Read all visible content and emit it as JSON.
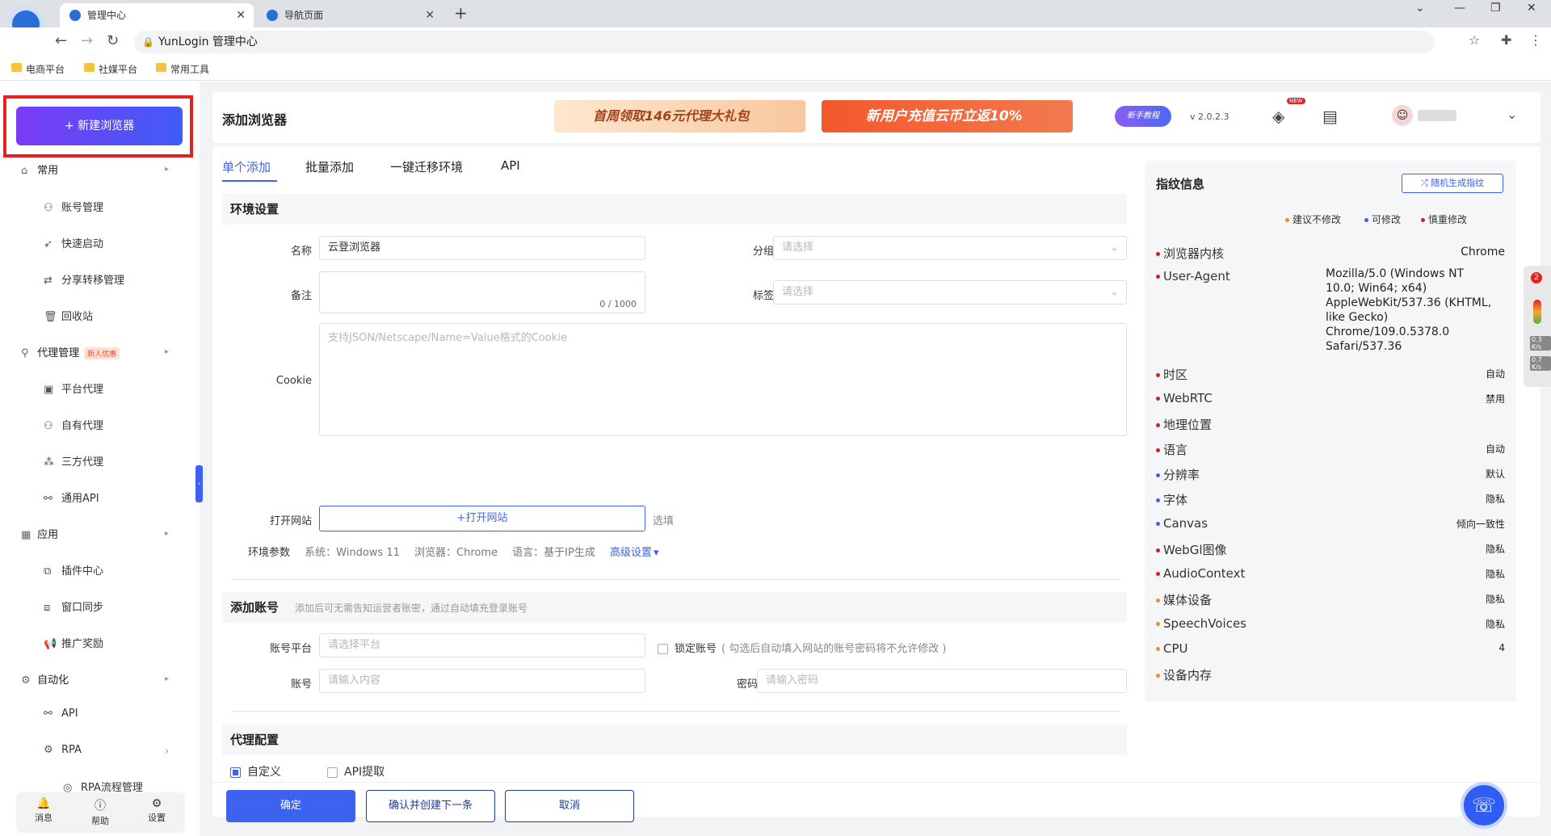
{
  "browser": {
    "tabs": [
      {
        "label": "管理中心"
      },
      {
        "label": "导航页面"
      }
    ],
    "address": "YunLogin 管理中心",
    "bookmarks": [
      "电商平台",
      "社媒平台",
      "常用工具"
    ]
  },
  "sidebar": {
    "new_browser": "+ 新建浏览器",
    "groups": {
      "common": "常用",
      "proxy": "代理管理",
      "proxy_badge": "新人优惠",
      "apps": "应用",
      "automation": "自动化"
    },
    "items": {
      "account_mgmt": "账号管理",
      "quick_launch": "快速启动",
      "share_transfer": "分享转移管理",
      "recycle": "回收站",
      "platform_proxy": "平台代理",
      "own_proxy": "自有代理",
      "third_proxy": "三方代理",
      "general_api": "通用API",
      "plugin_center": "插件中心",
      "window_sync": "窗口同步",
      "promo_reward": "推广奖励",
      "api": "API",
      "rpa": "RPA",
      "rpa_flow": "RPA流程管理"
    },
    "footer": {
      "messages": "消息",
      "help": "帮助",
      "settings": "设置"
    }
  },
  "header": {
    "title": "添加浏览器",
    "banner1": "首周领取146元代理大礼包",
    "banner2": "新用户充值云币立返10%",
    "tutorial": "新手教程",
    "version": "v 2.0.2.3",
    "new_badge": "NEW"
  },
  "tabs": [
    "单个添加",
    "批量添加",
    "一键迁移环境",
    "API"
  ],
  "env": {
    "section": "环境设置",
    "name_label": "名称",
    "name_value": "云登浏览器",
    "group_label": "分组",
    "group_placeholder": "请选择",
    "note_label": "备注",
    "note_counter": "0 / 1000",
    "tag_label": "标签",
    "tag_placeholder": "请选择",
    "cookie_label": "Cookie",
    "cookie_placeholder": "支持JSON/Netscape/Name=Value格式的Cookie",
    "open_site_label": "打开网站",
    "open_site_button": "+打开网站",
    "open_site_option": "选填",
    "params_label": "环境参数",
    "param_os": "系统：Windows 11",
    "param_browser": "浏览器：Chrome",
    "param_lang": "语言：基于IP生成",
    "advanced": "高级设置"
  },
  "account": {
    "section": "添加账号",
    "hint": "添加后可无需告知运营者账密，通过自动填充登录账号",
    "platform_label": "账号平台",
    "platform_placeholder": "请选择平台",
    "lock_label": "锁定账号",
    "lock_hint": "( 勾选后自动填入网站的账号密码将不允许修改 )",
    "account_label": "账号",
    "account_placeholder": "请输入内容",
    "password_label": "密码",
    "password_placeholder": "请输入密码"
  },
  "proxy": {
    "section": "代理配置",
    "custom": "自定义",
    "api_fetch": "API提取"
  },
  "buttons": {
    "confirm": "确定",
    "confirm_next": "确认并创建下一条",
    "cancel": "取消"
  },
  "fingerprint": {
    "title": "指纹信息",
    "random": "随机生成指纹",
    "legend": [
      {
        "label": "建议不修改",
        "color": "#f08c1a"
      },
      {
        "label": "可修改",
        "color": "#3e62f0"
      },
      {
        "label": "慎重修改",
        "color": "#d81e1e"
      }
    ],
    "rows": [
      {
        "name": "浏览器内核",
        "value": "Chrome",
        "color": "#d81e1e"
      },
      {
        "name": "User-Agent",
        "value": "",
        "color": "#d81e1e"
      },
      {
        "name": "时区",
        "value": "自动",
        "color": "#d81e1e"
      },
      {
        "name": "WebRTC",
        "value": "禁用",
        "color": "#d81e1e"
      },
      {
        "name": "地理位置",
        "value": "",
        "color": "#d81e1e"
      },
      {
        "name": "语言",
        "value": "自动",
        "color": "#d81e1e"
      },
      {
        "name": "分辨率",
        "value": "默认",
        "color": "#3e62f0"
      },
      {
        "name": "字体",
        "value": "隐私",
        "color": "#3e62f0"
      },
      {
        "name": "Canvas",
        "value": "倾向一致性",
        "color": "#3e62f0"
      },
      {
        "name": "WebGl图像",
        "value": "隐私",
        "color": "#d81e1e"
      },
      {
        "name": "AudioContext",
        "value": "隐私",
        "color": "#d81e1e"
      },
      {
        "name": "媒体设备",
        "value": "隐私",
        "color": "#f08c1a"
      },
      {
        "name": "SpeechVoices",
        "value": "隐私",
        "color": "#f08c1a"
      },
      {
        "name": "CPU",
        "value": "4",
        "color": "#f08c1a"
      },
      {
        "name": "设备内存",
        "value": "",
        "color": "#f08c1a"
      }
    ],
    "user_agent": "Mozilla/5.0 (Windows NT 10.0; Win64; x64) AppleWebKit/537.36 (KHTML, like Gecko) Chrome/109.0.5378.0 Safari/537.36"
  },
  "meter": {
    "badge": "2",
    "up": "0.3",
    "down": "0.7",
    "unit": "K/s"
  }
}
